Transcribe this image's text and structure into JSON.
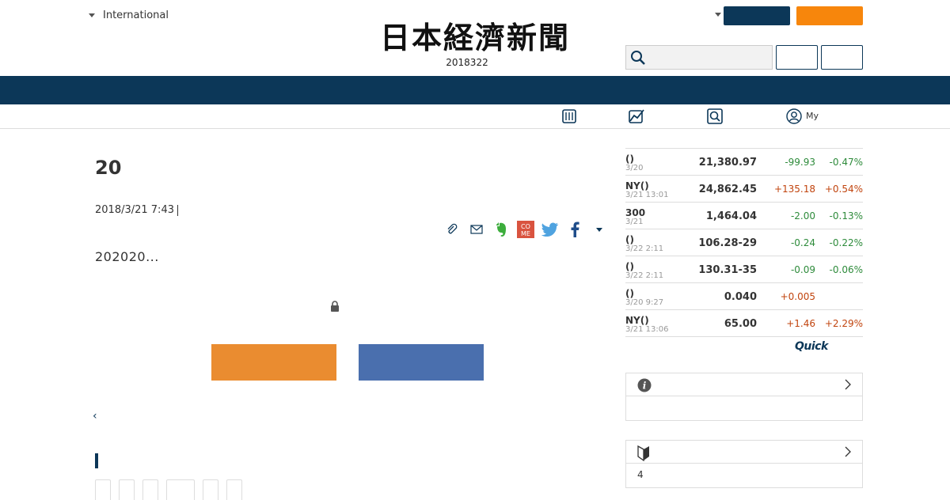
{
  "header": {
    "lang_label": "International",
    "logo_text": "日本経濟新聞",
    "date": "2018322"
  },
  "subnav": {
    "my_label": "My"
  },
  "article": {
    "title": "20",
    "datetime": "2018/3/21 7:43",
    "lead": "202020..."
  },
  "market": {
    "rows": [
      {
        "name": "()",
        "time": "3/20",
        "value": "21,380.97",
        "change": "-99.93",
        "pct": "-0.47%",
        "dir": "neg"
      },
      {
        "name": "NY()",
        "time": "3/21 13:01",
        "value": "24,862.45",
        "change": "+135.18",
        "pct": "+0.54%",
        "dir": "pos"
      },
      {
        "name": "300",
        "time": "3/21",
        "value": "1,464.04",
        "change": "-2.00",
        "pct": "-0.13%",
        "dir": "neg"
      },
      {
        "name": "()",
        "time": "3/22 2:11",
        "value": "106.28-29",
        "change": "-0.24",
        "pct": "-0.22%",
        "dir": "neg"
      },
      {
        "name": "()",
        "time": "3/22 2:11",
        "value": "130.31-35",
        "change": "-0.09",
        "pct": "-0.06%",
        "dir": "neg"
      },
      {
        "name": "()",
        "time": "3/20 9:27",
        "value": "0.040",
        "change": "+0.005",
        "pct": "",
        "dir": "pos"
      },
      {
        "name": "NY()",
        "time": "3/21 13:06",
        "value": "65.00",
        "change": "+1.46",
        "pct": "+2.29%",
        "dir": "pos"
      }
    ],
    "provider": "Quick"
  },
  "sidebar": {
    "box2_text": "4"
  },
  "colors": {
    "navy": "#0c3758",
    "orange": "#f7860c",
    "cta_orange": "#ea8c30",
    "cta_blue": "#4a6fae",
    "negative": "#2e8b3b",
    "positive": "#c1440e"
  }
}
